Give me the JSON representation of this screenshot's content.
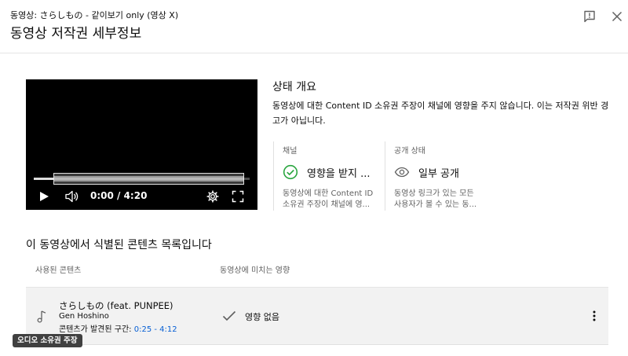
{
  "header": {
    "subtitle": "동영상: さらしもの - 같이보기 only (영상 X)",
    "title": "동영상 저작권 세부정보"
  },
  "player": {
    "time": "0:00 / 4:20",
    "progress_fraction": 0.09
  },
  "status": {
    "title": "상태 개요",
    "description": "동영상에 대한 Content ID 소유권 주장이 채널에 영향을 주지 않습니다. 이는 저작권 위반 경고가 아닙니다.",
    "cards": [
      {
        "label": "채널",
        "value": "영향을 받지 ...",
        "detail_line1": "동영상에 대한 Content ID",
        "detail_line2": "소유권 주장이 채널에 영..."
      },
      {
        "label": "공개 상태",
        "value": "일부 공개",
        "detail_line1": "동영상 링크가 있는 모든",
        "detail_line2": "사용자가 볼 수 있는 동..."
      }
    ]
  },
  "content_section": {
    "title": "이 동영상에서 식별된 콘텐츠 목록입니다",
    "columns": {
      "content": "사용된 콘텐츠",
      "impact": "동영상에 미치는 영향"
    },
    "rows": [
      {
        "title": "さらしもの (feat. PUNPEE)",
        "artist": "Gen Hoshino",
        "range_label": "콘텐츠가 발견된 구간: ",
        "range_value": "0:25 - 4:12",
        "impact": "영향 없음"
      }
    ]
  },
  "badge": "오디오 소유권 주장",
  "colors": {
    "link": "#065fd4",
    "success": "#2ba640",
    "row_bg": "#f2f2f2"
  },
  "icons": {
    "feedback": "feedback-icon",
    "close": "close-icon",
    "play": "play-icon",
    "volume": "volume-icon",
    "settings": "gear-icon",
    "fullscreen": "fullscreen-icon",
    "channel_status": "check-circle-icon",
    "visibility": "eye-icon",
    "music": "music-note-icon",
    "impact": "check-icon",
    "more": "more-vert-icon"
  }
}
